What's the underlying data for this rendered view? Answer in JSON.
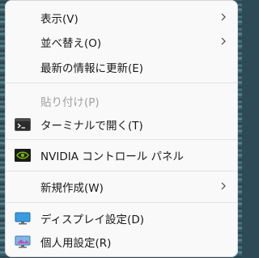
{
  "menu": {
    "items": [
      {
        "label": "表示(V)",
        "submenu": true
      },
      {
        "label": "並べ替え(O)",
        "submenu": true
      },
      {
        "label": "最新の情報に更新(E)"
      },
      {
        "label": "貼り付け(P)",
        "disabled": true
      },
      {
        "label": "ターミナルで開く(T)",
        "icon": "terminal-icon"
      },
      {
        "label": "NVIDIA コントロール パネル",
        "icon": "nvidia-icon"
      },
      {
        "label": "新規作成(W)",
        "submenu": true
      },
      {
        "label": "ディスプレイ設定(D)",
        "icon": "display-settings-icon"
      },
      {
        "label": "個人用設定(R)",
        "icon": "personalize-icon"
      }
    ]
  },
  "colors": {
    "menu_bg": "#f9f9f9",
    "text": "#1a1a1a",
    "disabled_text": "#a0a0a0",
    "divider": "#e3e3e3",
    "nvidia_green": "#76b900"
  }
}
